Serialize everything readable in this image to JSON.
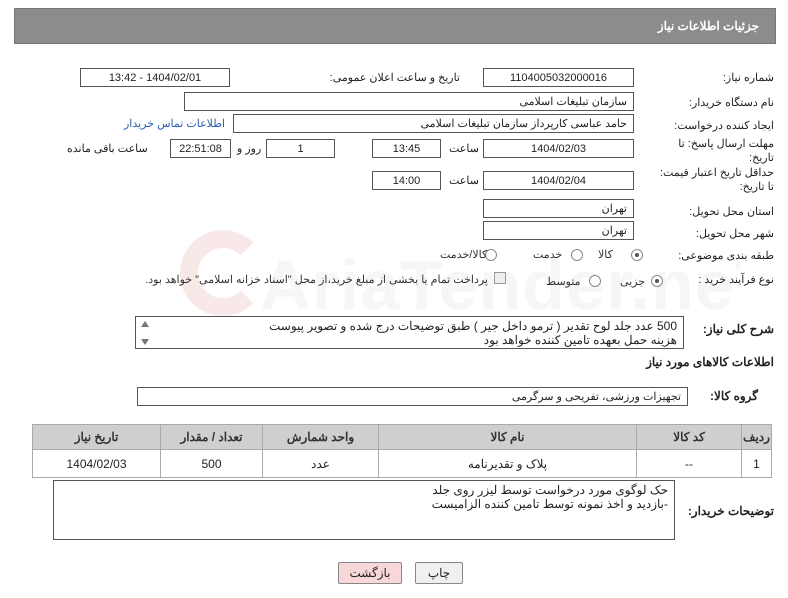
{
  "header": {
    "title": "جزئیات اطلاعات نیاز"
  },
  "fields": {
    "need_number_label": "شماره نیاز:",
    "need_number": "1104005032000016",
    "announce_label": "تاریخ و ساعت اعلان عمومی:",
    "announce_value": "1404/02/01 - 13:42",
    "buyer_org_label": "نام دستگاه خریدار:",
    "buyer_org": "سازمان تبلیغات اسلامی",
    "creator_label": "ایجاد کننده درخواست:",
    "creator": "حامد عباسی کارپرداز سازمان تبلیغات اسلامی",
    "contact_link": "اطلاعات تماس خریدار",
    "reply_deadline_label": "مهلت ارسال پاسخ: تا تاریخ:",
    "reply_date": "1404/02/03",
    "time_label": "ساعت",
    "reply_time": "13:45",
    "days_value": "1",
    "days_label": "روز و",
    "remaining_value": "22:51:08",
    "remaining_label": "ساعت باقی مانده",
    "price_valid_label": "حداقل تاریخ اعتبار قیمت: تا تاریخ:",
    "price_date": "1404/02/04",
    "price_time": "14:00",
    "province_label": "استان محل تحویل:",
    "province": "تهران",
    "city_label": "شهر محل تحویل:",
    "city": "تهران",
    "category_label": "طبقه بندی موضوعی:",
    "category_options": [
      "کالا",
      "خدمت",
      "کالا/خدمت"
    ],
    "purchase_type_label": "نوع فرآیند خرید :",
    "purchase_options": [
      "جزیی",
      "متوسط"
    ],
    "payment_note": "پرداخت تمام یا بخشی از مبلغ خرید،از محل \"اسناد خزانه اسلامی\" خواهد بود."
  },
  "description": {
    "label": "شرح کلی نیاز:",
    "lines": [
      "500 عدد جلد لوح تقدیر ( ترمو داخل جیر ) طبق توضیحات درج شده و تصویر پیوست",
      "هزینه حمل بعهده تامین کننده خواهد بود"
    ]
  },
  "goods_section": {
    "title": "اطلاعات کالاهای مورد نیاز",
    "group_label": "گروه کالا:",
    "group_value": "تجهیزات ورزشی، تفریحی و سرگرمی"
  },
  "table": {
    "headers": [
      "ردیف",
      "کد کالا",
      "نام کالا",
      "واحد شمارش",
      "تعداد / مقدار",
      "تاریخ نیاز"
    ],
    "rows": [
      [
        "1",
        "--",
        "پلاک و تقدیرنامه",
        "عدد",
        "500",
        "1404/02/03"
      ]
    ]
  },
  "buyer_notes": {
    "label": "توضیحات خریدار:",
    "lines": [
      "حک لوگوی مورد درخواست توسط لیزر روی جلد",
      "-بازدید و اخذ نمونه توسط تامین کننده الزامیست"
    ]
  },
  "buttons": {
    "print": "چاپ",
    "back": "بازگشت"
  },
  "watermark": {
    "text": "AriaTender.neT"
  },
  "colors": {
    "header_bg": "#8c8c8c",
    "link": "#2a5db0",
    "back_btn_bg": "#f7d7d7"
  }
}
